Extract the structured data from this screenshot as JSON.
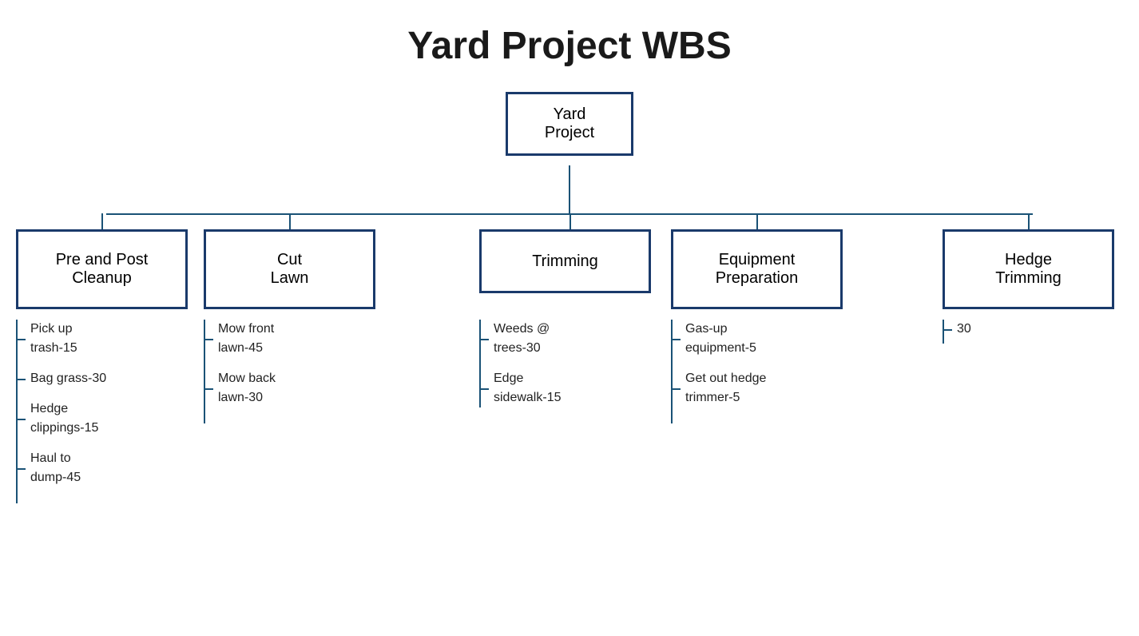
{
  "title": "Yard Project WBS",
  "root": {
    "label": "Yard\nProject"
  },
  "children": [
    {
      "id": "pre-post",
      "label": "Pre and Post\nCleanup",
      "items": [
        "Pick up trash-15",
        "Bag grass-30",
        "Hedge clippings-15",
        "Haul to dump-45"
      ]
    },
    {
      "id": "cut-lawn",
      "label": "Cut\nLawn",
      "items": [
        "Mow front lawn-45",
        "Mow back lawn-30"
      ]
    },
    {
      "id": "trimming",
      "label": "Trimming",
      "items": [
        "Weeds @ trees-30",
        "Edge sidewalk-15"
      ]
    },
    {
      "id": "equipment",
      "label": "Equipment\nPreparation",
      "items": [
        "Gas-up equipment-5",
        "Get out hedge trimmer-5"
      ]
    },
    {
      "id": "hedge",
      "label": "Hedge\nTrimming",
      "items": [
        "30"
      ]
    }
  ]
}
